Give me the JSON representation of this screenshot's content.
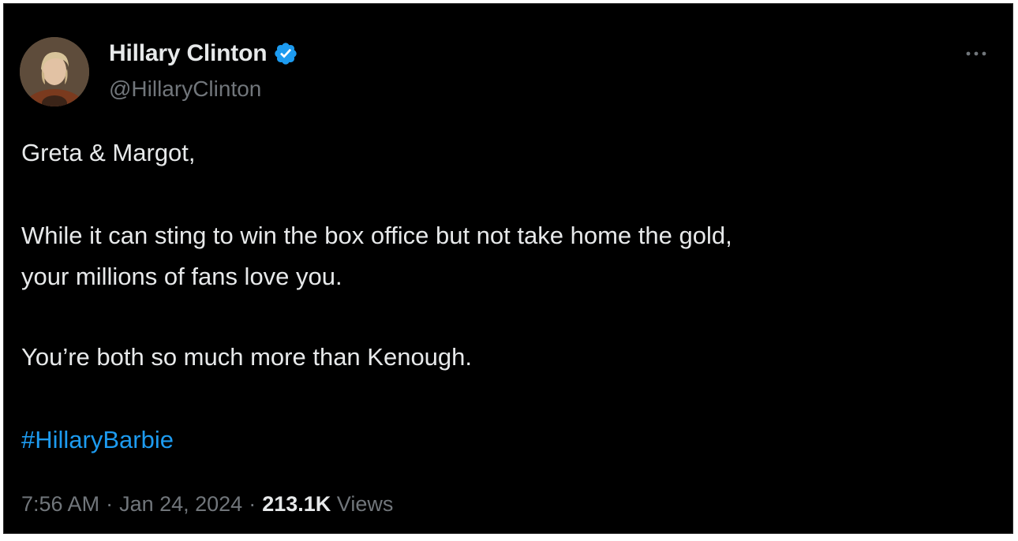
{
  "tweet": {
    "author": {
      "display_name": "Hillary Clinton",
      "handle": "@HillaryClinton",
      "verified": true
    },
    "body": {
      "line1": "Greta & Margot,",
      "line2": "While it can sting to win the box office but not take home the gold,",
      "line3": "your millions of fans love you.",
      "line4": "You’re both so much more than Kenough.",
      "hashtag": "#HillaryBarbie"
    },
    "meta": {
      "time": "7:56 AM",
      "date": "Jan 24, 2024",
      "separator": "·",
      "views_count": "213.1K",
      "views_label": "Views"
    },
    "icons": {
      "verified": "verified-badge-icon",
      "more": "more-options-icon"
    },
    "colors": {
      "background": "#000000",
      "text": "#e7e9ea",
      "secondary_text": "#71767b",
      "link": "#1d9bf0",
      "verified_badge": "#1d9bf0"
    }
  }
}
